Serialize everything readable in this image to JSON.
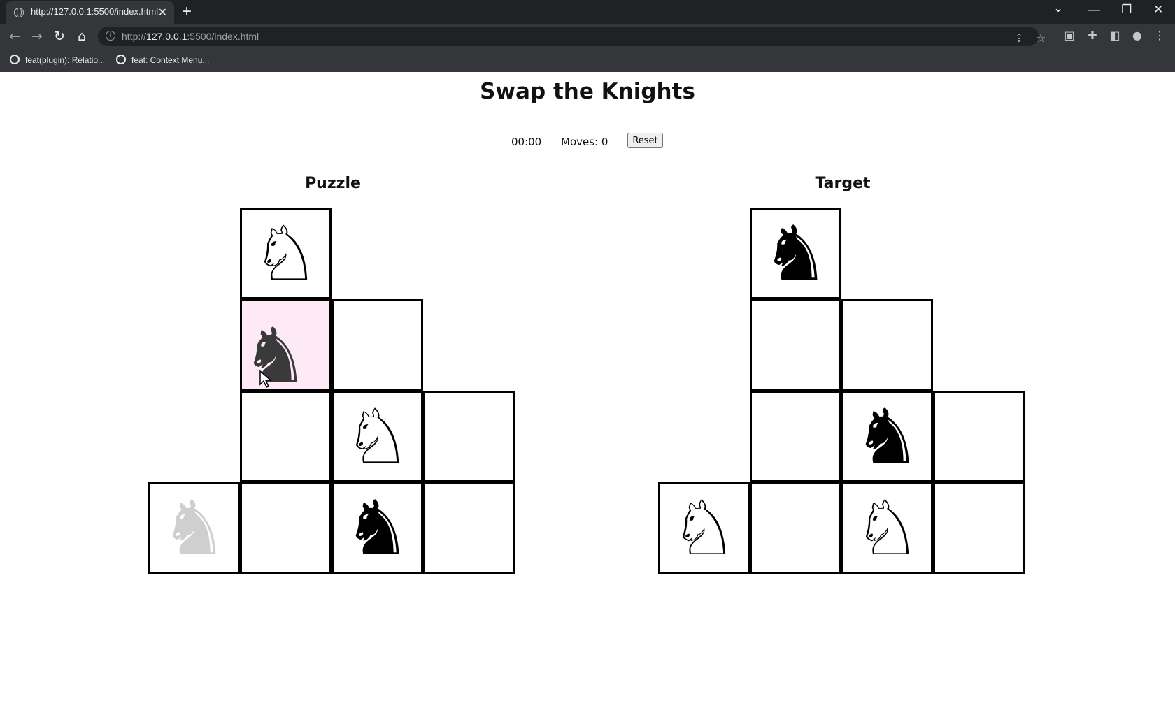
{
  "browser": {
    "tab_title": "http://127.0.0.1:5500/index.html",
    "tab_close": "✕",
    "new_tab": "+",
    "url_prefix": "http://",
    "url_host": "127.0.0.1",
    "url_rest": ":5500/index.html",
    "bookmarks": [
      {
        "label": "feat(plugin): Relatio..."
      },
      {
        "label": "feat: Context Menu..."
      }
    ]
  },
  "page": {
    "title": "Swap the Knights",
    "timer": "00:00",
    "moves": "Moves: 0",
    "reset_label": "Reset"
  },
  "boards": {
    "puzzle_title": "Puzzle",
    "target_title": "Target",
    "cells": [
      "r0c1",
      "r1c1",
      "r1c2",
      "r2c1",
      "r2c2",
      "r2c3",
      "r3c0",
      "r3c1",
      "r3c2",
      "r3c3"
    ],
    "puzzle_pieces": {
      "r0c1": "white",
      "r1c1": "dragging-black",
      "r2c2": "white",
      "r3c0": "ghost",
      "r3c2": "black"
    },
    "puzzle_highlight": "r1c1",
    "target_pieces": {
      "r0c1": "black",
      "r2c2": "black",
      "r3c0": "white",
      "r3c2": "white"
    }
  },
  "colors": {
    "highlight": "#fdeaf6",
    "ghost_knight": "#cfcfcf",
    "chrome_bg": "#35363a"
  },
  "glyphs": {
    "white_knight": "♘",
    "black_knight": "♞"
  }
}
